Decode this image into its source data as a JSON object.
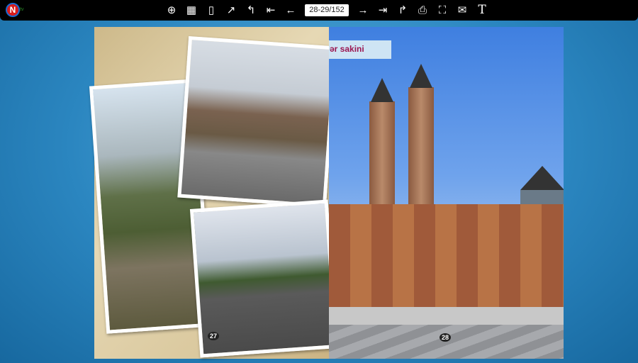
{
  "toolbar": {
    "logo": {
      "letter": "N",
      "text": "tv"
    },
    "page_indicator": "28-29/152",
    "icons": [
      "zoom-in-icon",
      "thumbnails-icon",
      "single-page-icon",
      "share-icon",
      "first-page-back-icon",
      "first-page-icon",
      "previous-page-icon",
      "next-page-icon",
      "last-page-icon",
      "forward-icon",
      "print-icon",
      "fullscreen-icon",
      "email-icon",
      "text-icon"
    ]
  },
  "book": {
    "left_page_number": "27",
    "right_page_number": "28",
    "caption": "ər sakini"
  }
}
